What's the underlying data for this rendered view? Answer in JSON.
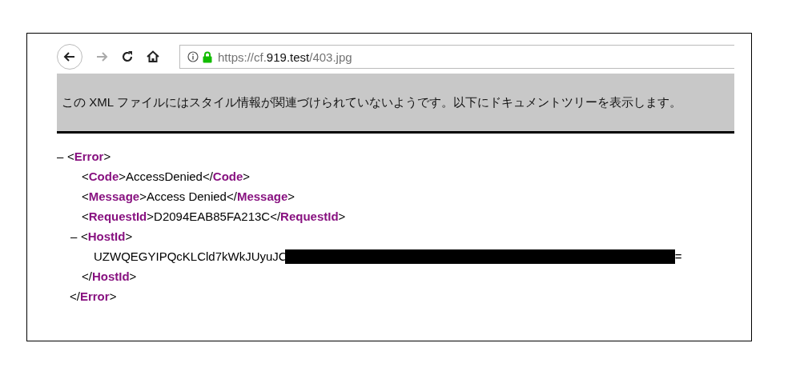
{
  "toolbar": {
    "address": {
      "prefix": "https://cf.",
      "domain": "919.test",
      "path": "/403.jpg"
    }
  },
  "notice": "この XML ファイルにはスタイル情報が関連づけられていないようです。以下にドキュメントツリーを表示します。",
  "tree": {
    "toggle": "–",
    "open": "<**Error**>",
    "close": "</**Error**>",
    "children": [
      {
        "kind": "inline",
        "open": "<**Code**>",
        "text": "AccessDenied",
        "close": "</**Code**>"
      },
      {
        "kind": "inline",
        "open": "<**Message**>",
        "text": "Access Denied",
        "close": "</**Message**>"
      },
      {
        "kind": "inline",
        "open": "<**RequestId**>",
        "text": "D2094EAB85FA213C",
        "close": "</**RequestId**>"
      },
      {
        "kind": "block",
        "toggle": "–",
        "open": "<**HostId**>",
        "text": "UZWQEGYIPQcKLCld7kWkJUyuJC",
        "redacted": true,
        "text_after": "=",
        "close": "</**HostId**>"
      }
    ]
  }
}
